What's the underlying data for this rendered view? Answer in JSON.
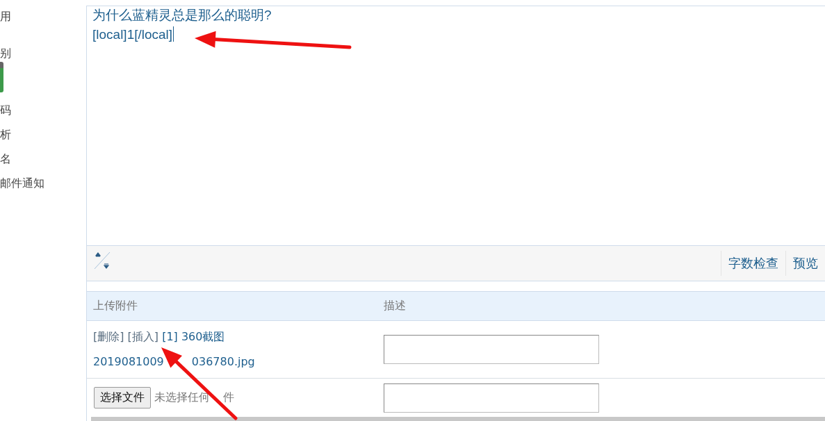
{
  "sidebar": {
    "items": [
      "用",
      "别",
      "码",
      "析",
      "名",
      "邮件通知"
    ]
  },
  "editor": {
    "lines": [
      "为什么蓝精灵总是那么的聪明?",
      "[local]1[/local]"
    ],
    "toolbar_buttons": [
      "字数检查",
      "预览"
    ]
  },
  "attachments": {
    "columns": [
      "上传附件",
      "描述"
    ],
    "files": [
      {
        "actions": [
          "[删除]",
          "[插入]"
        ],
        "index": "[1]",
        "name_parts": [
          "360截图",
          "2019081009",
          "036780.jpg"
        ]
      }
    ],
    "picker": {
      "button": "选择文件",
      "status_parts": [
        "未选择任何",
        "件"
      ]
    }
  },
  "annotations": [
    {
      "kind": "arrow"
    },
    {
      "kind": "arrow"
    }
  ]
}
